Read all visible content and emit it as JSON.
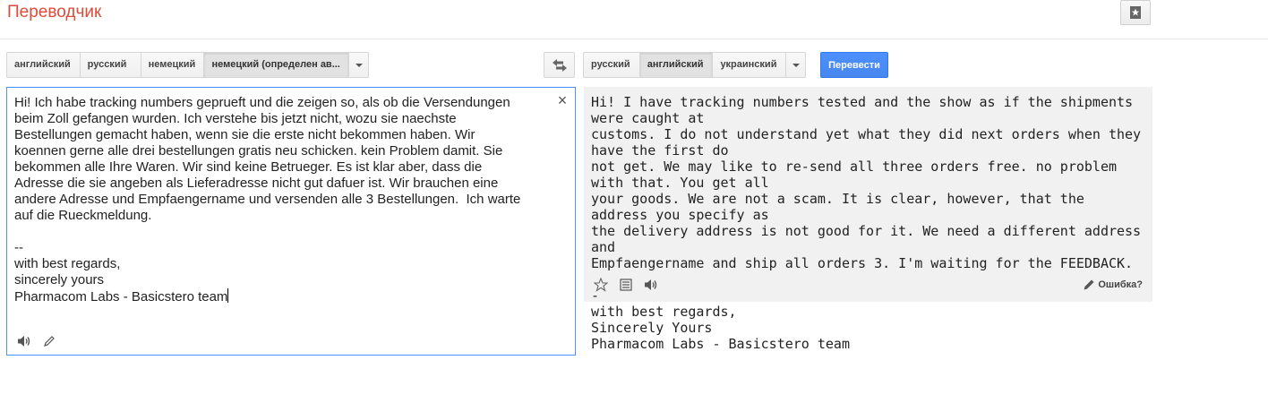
{
  "app": {
    "title": "Переводчик"
  },
  "source": {
    "languages": [
      "английский",
      "русский",
      "немецкий",
      "немецкий (определен ав..."
    ],
    "active_index": 3,
    "text": "Hi! Ich habe tracking numbers geprueft und die zeigen so, als ob die Versendungen\nbeim Zoll gefangen wurden. Ich verstehe bis jetzt nicht, wozu sie naechste\nBestellungen gemacht haben, wenn sie die erste nicht bekommen haben. Wir\nkoennen gerne alle drei bestellungen gratis neu schicken. kein Problem damit. Sie\nbekommen alle Ihre Waren. Wir sind keine Betrueger. Es ist klar aber, dass die\nAdresse die sie angeben als Lieferadresse nicht gut dafuer ist. Wir brauchen eine\nandere Adresse und Empfaengername und versenden alle 3 Bestellungen.  Ich warte\nauf die Rueckmeldung.\n\n--\nwith best regards,\nsincerely yours\nPharmacom Labs - Basicstero team",
    "clear_symbol": "×"
  },
  "target": {
    "languages": [
      "русский",
      "английский",
      "украинский"
    ],
    "active_index": 1,
    "translate_label": "Перевести",
    "text": "Hi! I have tracking numbers tested and the show as if the shipments were caught at\ncustoms. I do not understand yet what they did next orders when they have the first do\nnot get. We may like to re-send all three orders free. no problem with that. You get all\nyour goods. We are not a scam. It is clear, however, that the address you specify as\nthe delivery address is not good for it. We need a different address and\nEmpfaengername and ship all orders 3. I'm waiting for the FEEDBACK.\n\n-\nwith best regards,\nSincerely Yours\nPharmacom Labs - Basicstero team",
    "error_label": "Ошибка?"
  },
  "colors": {
    "title": "#dd4b39",
    "translate_button": "#4d90fe",
    "focus_border": "#4d90fe",
    "result_bg": "#f1f1f1"
  },
  "icons": [
    "phrasebook-icon",
    "swap-icon",
    "speaker-icon",
    "pencil-icon",
    "star-icon",
    "list-icon"
  ]
}
